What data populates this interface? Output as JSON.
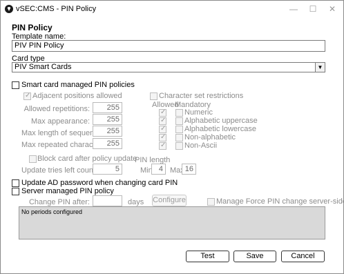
{
  "window": {
    "title": "vSEC:CMS - PIN Policy",
    "minimize": "—",
    "maximize": "☐",
    "close": "✕"
  },
  "heading": "PIN Policy",
  "template": {
    "label": "Template name:",
    "value": "PIV PIN Policy"
  },
  "card_type": {
    "label": "Card type",
    "value": "PIV Smart Cards"
  },
  "smart_card_managed": {
    "label": "Smart card managed PIN policies",
    "adjacent": "Adjacent positions allowed",
    "allowed_repetitions": {
      "label": "Allowed repetitions:",
      "value": "255"
    },
    "max_appearance": {
      "label": "Max appearance:",
      "value": "255"
    },
    "max_length_sequence": {
      "label": "Max length of sequence:",
      "value": "255"
    },
    "max_repeated_chars": {
      "label": "Max repeated characters:",
      "value": "255"
    },
    "block_card": "Block card after policy update",
    "update_tries": {
      "label": "Update tries left counter:",
      "value": "5"
    },
    "pin_length": {
      "label": "PIN length",
      "min_label": "Min:",
      "min_value": "4",
      "max_label": "Max:",
      "max_value": "16"
    }
  },
  "charset": {
    "label": "Character set restrictions",
    "col_allowed": "Allowed",
    "col_mandatory": "Mandatory",
    "rows": [
      "Numeric",
      "Alphabetic uppercase",
      "Alphabetic lowercase",
      "Non-alphabetic",
      "Non-Ascii"
    ]
  },
  "update_ad": "Update AD password when changing card PIN",
  "server_managed": {
    "label": "Server managed PIN policy",
    "change_pin_after": "Change PIN after:",
    "days": "days",
    "configure": "Configure",
    "manage_force": "Manage Force PIN change server-side",
    "periods_text": "No periods configured"
  },
  "buttons": {
    "test": "Test",
    "save": "Save",
    "cancel": "Cancel"
  }
}
